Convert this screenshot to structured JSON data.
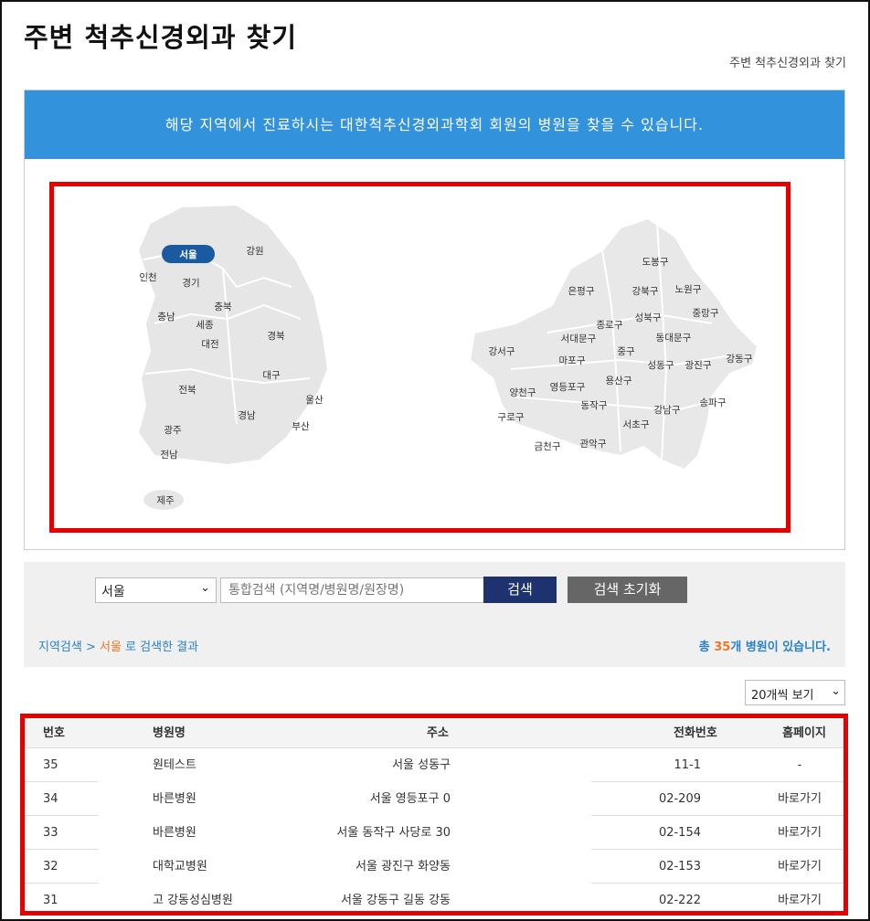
{
  "page": {
    "title": "주변 척추신경외과 찾기",
    "breadcrumb": "주변 척추신경외과 찾기"
  },
  "banner": {
    "text": "해당 지역에서 진료하시는 대한척추신경외과학회 회원의 병원을 찾을 수 있습니다."
  },
  "korea_map": {
    "selected": "서울",
    "regions": [
      "서울",
      "강원",
      "인천",
      "경기",
      "충북",
      "충남",
      "세종",
      "대전",
      "경북",
      "대구",
      "전북",
      "울산",
      "경남",
      "부산",
      "광주",
      "전남",
      "제주"
    ]
  },
  "seoul_map": {
    "districts": [
      "도봉구",
      "은평구",
      "강북구",
      "노원구",
      "성북구",
      "중랑구",
      "종로구",
      "서대문구",
      "동대문구",
      "강서구",
      "마포구",
      "중구",
      "성동구",
      "광진구",
      "강동구",
      "양천구",
      "영등포구",
      "용산구",
      "구로구",
      "동작구",
      "송파구",
      "강남구",
      "서초구",
      "금천구",
      "관악구"
    ]
  },
  "search": {
    "region_value": "서울",
    "placeholder": "통합검색 (지역명/병원명/원장명)",
    "search_label": "검색",
    "reset_label": "검색 초기화"
  },
  "result": {
    "prefix": "지역검색 >",
    "region": "서울",
    "suffix": "로 검색한 결과",
    "total_prefix": "총",
    "total_count": "35",
    "total_suffix": "개 병원이 있습니다."
  },
  "per_page": {
    "value": "20개씩 보기"
  },
  "table": {
    "headers": [
      "번호",
      "병원명",
      "주소",
      "전화번호",
      "홈페이지"
    ],
    "rows": [
      {
        "no": "35",
        "name": "원테스트",
        "addr": "서울 성동구",
        "tel": "11-1",
        "home": "-"
      },
      {
        "no": "34",
        "name": "바른병원",
        "addr": "서울 영등포구 0",
        "tel": "02-209",
        "home": "바로가기"
      },
      {
        "no": "33",
        "name": "바른병원",
        "addr": "서울 동작구 사당로 30",
        "tel": "02-154",
        "home": "바로가기"
      },
      {
        "no": "32",
        "name": "대학교병원",
        "addr": "서울 광진구 화양동",
        "tel": "02-153",
        "home": "바로가기"
      },
      {
        "no": "31",
        "name": "고 강동성심병원",
        "addr": "서울 강동구 길동 강동",
        "tel": "02-222",
        "home": "바로가기"
      }
    ]
  },
  "colors": {
    "banner": "#3292dc",
    "highlight_red": "#e60000",
    "search_button": "#1f3270",
    "reset_button": "#666666",
    "accent_orange": "#f07820",
    "link_blue": "#2a82c8"
  }
}
